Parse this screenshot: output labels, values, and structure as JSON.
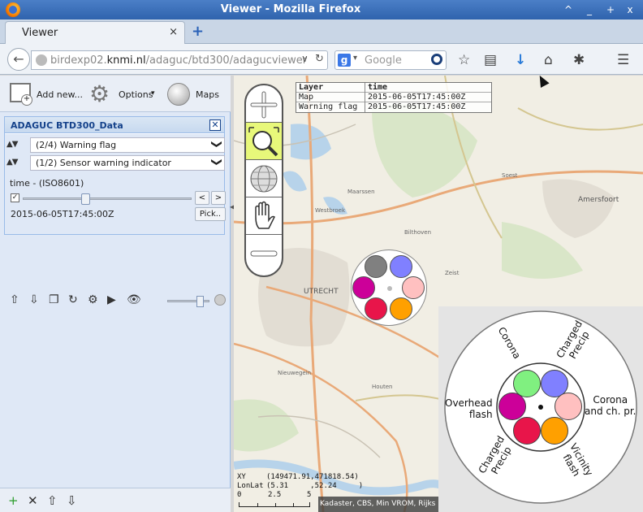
{
  "window": {
    "title": "Viewer - Mozilla Firefox",
    "controls": [
      "^",
      "_",
      "+",
      "x"
    ]
  },
  "tab": {
    "label": "Viewer",
    "close": "×",
    "new": "+"
  },
  "nav": {
    "url_prefix": "birdexp02.",
    "url_domain": "knmi.nl",
    "url_path": "/adaguc/btd300/adagucviewer",
    "search_placeholder": "Google",
    "search_engine_letter": "g",
    "icons": [
      "back-icon",
      "star-icon",
      "reading-list-icon",
      "download-icon",
      "home-icon",
      "addon-icon",
      "menu-icon"
    ],
    "glyphs": {
      "back": "←",
      "drop": "∨",
      "reload": "↻",
      "star": "☆",
      "list": "▤",
      "download": "↓",
      "home": "⌂",
      "addon": "✱",
      "menu": "☰"
    }
  },
  "toolbar": {
    "add_new": "Add new...",
    "options": "Options",
    "options_caret": "▾",
    "maps": "Maps"
  },
  "data_panel": {
    "title": "ADAGUC BTD300_Data",
    "close": "✕",
    "layers": [
      {
        "label": "(2/4) Warning flag"
      },
      {
        "label": "(1/2) Sensor warning indicator"
      }
    ],
    "updown": "▲▼",
    "chevron": "❯",
    "time_label": "time - (ISO8601)",
    "time_checked": "✓",
    "time_value": "2015-06-05T17:45:00Z",
    "time_slider_fraction": 0.36,
    "prev_label": "<",
    "next_label": ">",
    "pick_label": "Pick..",
    "tools": [
      "⇧",
      "⇩",
      "❐",
      "↻",
      "⚙",
      "▶",
      "👁"
    ],
    "opacity_fraction": 0.8
  },
  "panel_bottom": {
    "icons": [
      "+",
      "✕",
      "⇧",
      "⇩"
    ]
  },
  "map": {
    "legend_table": {
      "header": [
        "Layer",
        "time"
      ],
      "rows": [
        [
          "Map",
          "2015-06-05T17:45:00Z"
        ],
        [
          "Warning flag",
          "2015-06-05T17:45:00Z"
        ]
      ]
    },
    "place_labels": [
      "UTRECHT",
      "Amersfoort",
      "Maarssen",
      "Bilthoven",
      "Zeist",
      "Houten",
      "Nieuwegein",
      "Westbroek",
      "Soest"
    ],
    "coords": {
      "xy_label": "XY",
      "xy_value": "(149471.91,471818.54)",
      "lonlat_label": "LonLat",
      "lonlat_value": "(5.31     ,52.24     )",
      "scale_labels": [
        "0",
        "2.5",
        "5"
      ]
    },
    "attribution": "Kadaster, CBS, Min VROM, Rijks",
    "mini_colors": [
      "#808080",
      "#8080ff",
      "#cc0099",
      "#ffc0c0",
      "#e8154a",
      "#ffa000"
    ],
    "big_legend": {
      "labels": {
        "corona": "Corona",
        "charged_precip_top": "Charged\nPrecip",
        "overhead": "Overhead\nflash",
        "corona_ch": "Corona\nand ch. pr.",
        "charged_precip_bottom": "Charged\nPrecip",
        "vicinity": "Vicinity\nflash"
      },
      "colors": {
        "corona": "#80f080",
        "charged_precip_top": "#8080ff",
        "overhead": "#cc0099",
        "corona_ch": "#ffc0c0",
        "charged_precip_bottom": "#e8154a",
        "vicinity": "#ffa000"
      }
    }
  }
}
